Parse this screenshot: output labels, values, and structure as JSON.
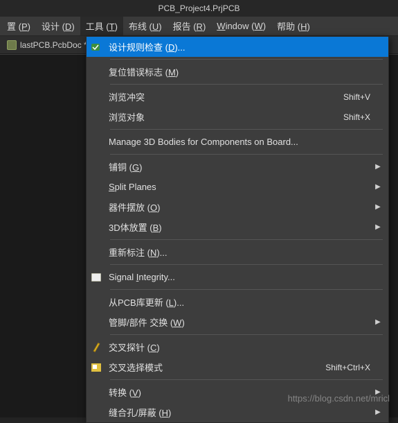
{
  "title": "PCB_Project4.PrjPCB",
  "menubar": [
    {
      "pre": "置 (",
      "mn": "P",
      "post": ")"
    },
    {
      "pre": "设计 (",
      "mn": "D",
      "post": ")"
    },
    {
      "pre": "工具 (",
      "mn": "T",
      "post": ")",
      "active": true
    },
    {
      "pre": "布线 (",
      "mn": "U",
      "post": ")"
    },
    {
      "pre": "报告 (",
      "mn": "R",
      "post": ")"
    },
    {
      "pre": "",
      "mn": "W",
      "post": "indow (W)",
      "raw": "Window (W)",
      "underlineIndex": 0
    },
    {
      "pre": "帮助 (",
      "mn": "H",
      "post": ")"
    }
  ],
  "docTab": {
    "label": "lastPCB.PcbDoc *"
  },
  "dropdown": [
    {
      "type": "item",
      "icon": "green-check",
      "label_pre": "设计规则检查 (",
      "label_mn": "D",
      "label_post": ")...",
      "selected": true
    },
    {
      "type": "sep"
    },
    {
      "type": "item",
      "label_pre": "复位错误标志 (",
      "label_mn": "M",
      "label_post": ")"
    },
    {
      "type": "sep"
    },
    {
      "type": "item",
      "label_pre": "浏览冲突",
      "label_mn": "",
      "label_post": "",
      "shortcut": "Shift+V"
    },
    {
      "type": "item",
      "label_pre": "浏览对象",
      "label_mn": "",
      "label_post": "",
      "shortcut": "Shift+X"
    },
    {
      "type": "sep"
    },
    {
      "type": "item",
      "label_pre": "Manage 3D Bodies for Components on Board...",
      "label_mn": "",
      "label_post": ""
    },
    {
      "type": "sep"
    },
    {
      "type": "item",
      "label_pre": "铺铜 (",
      "label_mn": "G",
      "label_post": ")",
      "submenu": true
    },
    {
      "type": "item",
      "label_pre": "",
      "label_mn": "S",
      "label_post": "plit Planes",
      "submenu": true
    },
    {
      "type": "item",
      "label_pre": "器件摆放 (",
      "label_mn": "O",
      "label_post": ")",
      "submenu": true
    },
    {
      "type": "item",
      "label_pre": "3D体放置 (",
      "label_mn": "B",
      "label_post": ")",
      "submenu": true
    },
    {
      "type": "sep"
    },
    {
      "type": "item",
      "label_pre": "重新标注 (",
      "label_mn": "N",
      "label_post": ")..."
    },
    {
      "type": "sep"
    },
    {
      "type": "item",
      "icon": "clip",
      "label_pre": "Signal ",
      "label_mn": "I",
      "label_post": "ntegrity..."
    },
    {
      "type": "sep"
    },
    {
      "type": "item",
      "label_pre": "从PCB库更新 (",
      "label_mn": "L",
      "label_post": ")..."
    },
    {
      "type": "item",
      "label_pre": "管脚/部件 交换 (",
      "label_mn": "W",
      "label_post": ")",
      "submenu": true
    },
    {
      "type": "sep"
    },
    {
      "type": "item",
      "icon": "pin",
      "label_pre": "交叉探针 (",
      "label_mn": "C",
      "label_post": ")"
    },
    {
      "type": "item",
      "icon": "sel",
      "label_pre": "交叉选择模式",
      "label_mn": "",
      "label_post": "",
      "shortcut": "Shift+Ctrl+X"
    },
    {
      "type": "sep"
    },
    {
      "type": "item",
      "label_pre": "转换 (",
      "label_mn": "V",
      "label_post": ")",
      "submenu": true
    },
    {
      "type": "item",
      "label_pre": "缝合孔/屏蔽 (",
      "label_mn": "H",
      "label_post": ")",
      "submenu": true
    }
  ],
  "watermark": "https://blog.csdn.net/mricl"
}
